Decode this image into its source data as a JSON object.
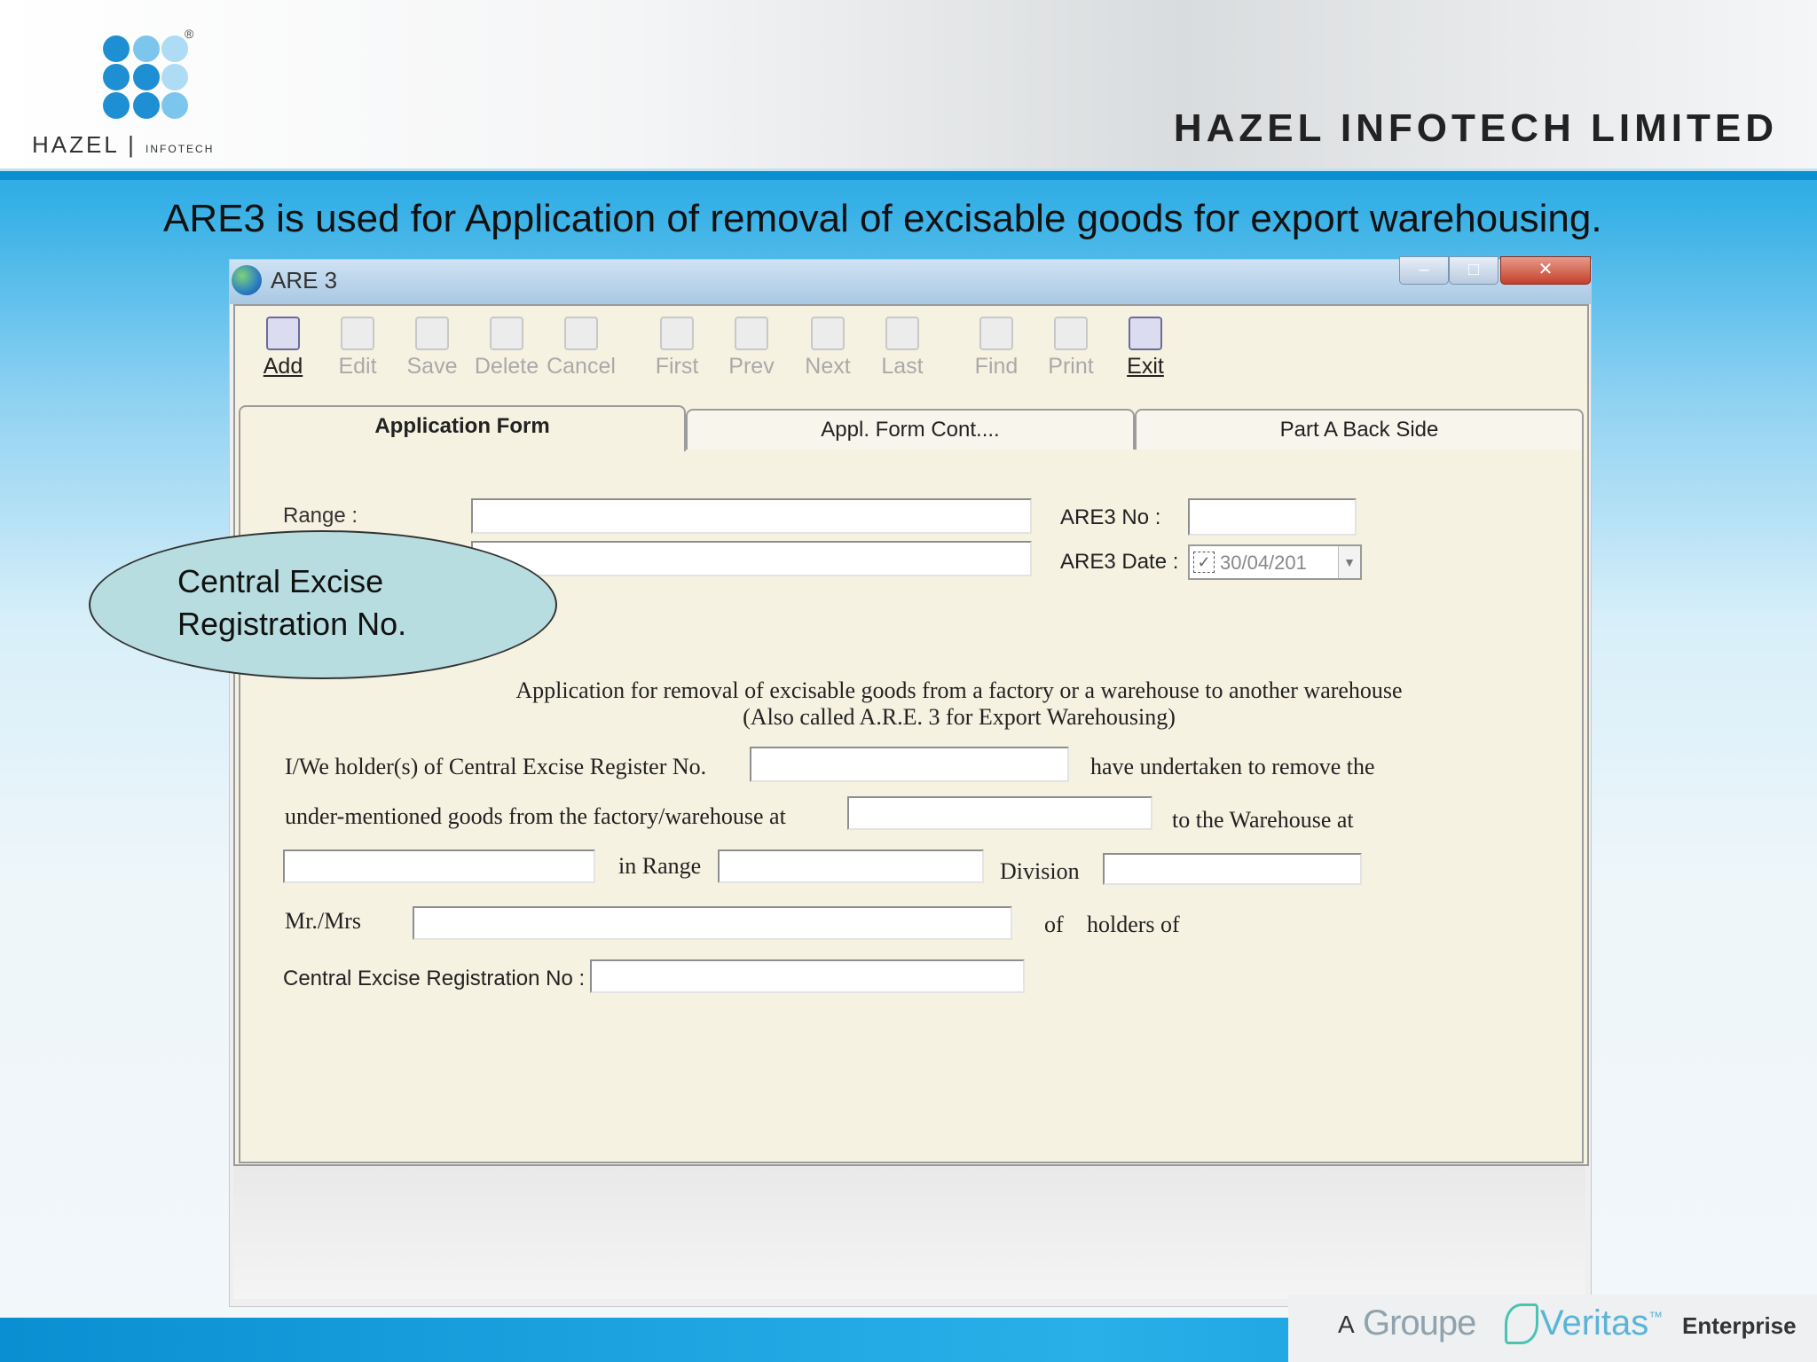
{
  "header": {
    "logo_brand": "HAZEL",
    "logo_sub": "INFOTECH",
    "logo_reg": "®",
    "company": "HAZEL INFOTECH LIMITED"
  },
  "slide_title": "ARE3 is used for Application of removal of excisable goods for export warehousing.",
  "window": {
    "title": "ARE 3",
    "toolbar": [
      {
        "label": "Add",
        "enabled": true
      },
      {
        "label": "Edit",
        "enabled": false
      },
      {
        "label": "Save",
        "enabled": false
      },
      {
        "label": "Delete",
        "enabled": false
      },
      {
        "label": "Cancel",
        "enabled": false
      },
      {
        "label": "First",
        "enabled": false
      },
      {
        "label": "Prev",
        "enabled": false
      },
      {
        "label": "Next",
        "enabled": false
      },
      {
        "label": "Last",
        "enabled": false
      },
      {
        "label": "Find",
        "enabled": false
      },
      {
        "label": "Print",
        "enabled": false
      },
      {
        "label": "Exit",
        "enabled": true
      }
    ],
    "tabs": [
      {
        "label": "Application Form",
        "active": true
      },
      {
        "label": "Appl. Form Cont....",
        "active": false
      },
      {
        "label": "Part A Back Side",
        "active": false
      }
    ],
    "form": {
      "range_label": "Range :",
      "are3_no_label": "ARE3 No :",
      "are3_date_label": "ARE3 Date :",
      "are3_date_value": "30/04/201",
      "heading_line1": "Application for removal of excisable goods from a factory or a warehouse to another warehouse",
      "heading_line2": "(Also called A.R.E. 3 for Export Warehousing)",
      "holder_prefix": "I/We holder(s) of Central Excise Register No.",
      "holder_suffix": "have undertaken to remove the",
      "goods_prefix": "under-mentioned goods from the factory/warehouse at",
      "goods_suffix": "to the Warehouse at",
      "in_range": "in Range",
      "division": "Division",
      "mr_mrs": "Mr./Mrs",
      "of": "of",
      "holders_of": "holders of",
      "cer_no_label": "Central Excise Registration No :"
    }
  },
  "callout": {
    "line1": "Central Excise",
    "line2": "Registration No."
  },
  "footer": {
    "a": "A",
    "groupe": "Groupe",
    "veritas": "Veritas",
    "tm": "™",
    "enterprise": "Enterprise"
  },
  "colors": {
    "accent_blue": "#0a90d2",
    "form_bg": "#f6f2e2",
    "callout_fill": "#b8dde0"
  }
}
